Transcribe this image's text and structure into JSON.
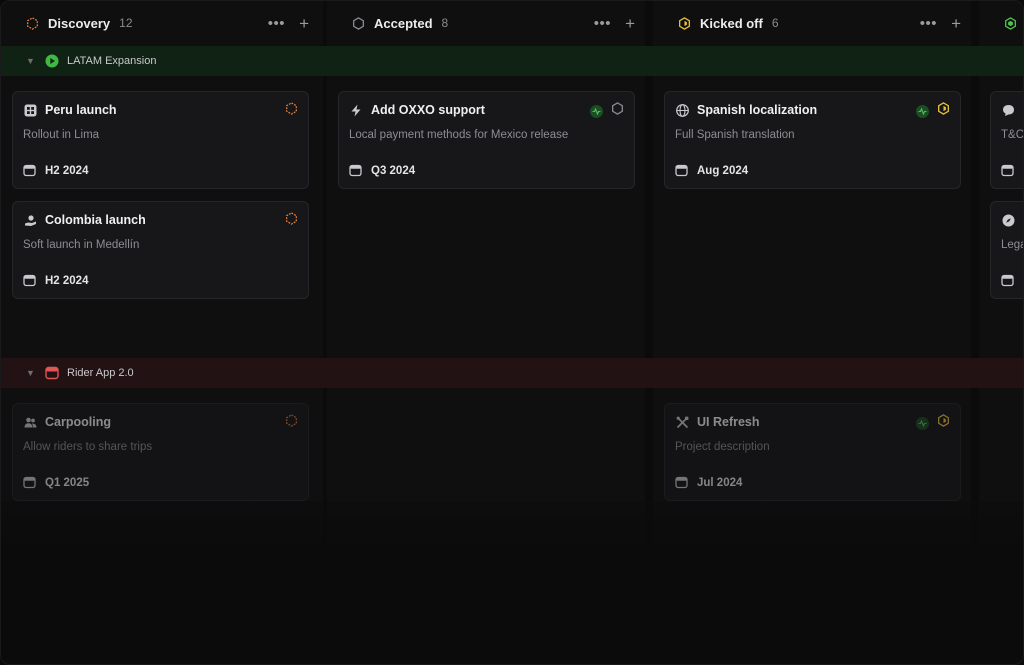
{
  "columns": [
    {
      "title": "Discovery",
      "count": "12",
      "icon": "discovery-hexagon-icon",
      "color": "#e07a3a"
    },
    {
      "title": "Accepted",
      "count": "8",
      "icon": "accepted-hexagon-icon",
      "color": "#8a8a90"
    },
    {
      "title": "Kicked off",
      "count": "6",
      "icon": "kicked-off-hexagon-icon",
      "color": "#e8c23a"
    },
    {
      "title": "",
      "count": "",
      "icon": "in-progress-hexagon-icon",
      "color": "#4ec24e"
    }
  ],
  "groups": [
    {
      "label": "LATAM Expansion",
      "icon": "play-circle-icon",
      "color": "#3fb944"
    },
    {
      "label": "Rider App 2.0",
      "icon": "calendar-icon",
      "color": "#e05555"
    }
  ],
  "cards": {
    "peru": {
      "title": "Peru launch",
      "desc": "Rollout in Lima",
      "date": "H2 2024",
      "icon": "grid-icon"
    },
    "colombia": {
      "title": "Colombia launch",
      "desc": "Soft launch in Medellín",
      "date": "H2 2024",
      "icon": "hand-icon"
    },
    "oxxo": {
      "title": "Add OXXO support",
      "desc": "Local payment methods for Mexico release",
      "date": "Q3 2024",
      "icon": "bolt-icon"
    },
    "spanish": {
      "title": "Spanish localization",
      "desc": "Full Spanish translation",
      "date": "Aug 2024",
      "icon": "globe-icon"
    },
    "carpooling": {
      "title": "Carpooling",
      "desc": "Allow riders to share trips",
      "date": "Q1 2025",
      "icon": "users-icon"
    },
    "uirefresh": {
      "title": "UI Refresh",
      "desc": "Project description",
      "date": "Jul 2024",
      "icon": "tools-icon"
    },
    "partial1": {
      "title": "",
      "desc": "T&C",
      "date": "",
      "icon": "chat-icon"
    },
    "partial2": {
      "title": "",
      "desc": "Lega",
      "date": "",
      "icon": "compass-icon"
    }
  },
  "colors": {
    "discovery": "#e07a3a",
    "kicked_off": "#e8c23a",
    "health_ok": "#3fb944"
  }
}
